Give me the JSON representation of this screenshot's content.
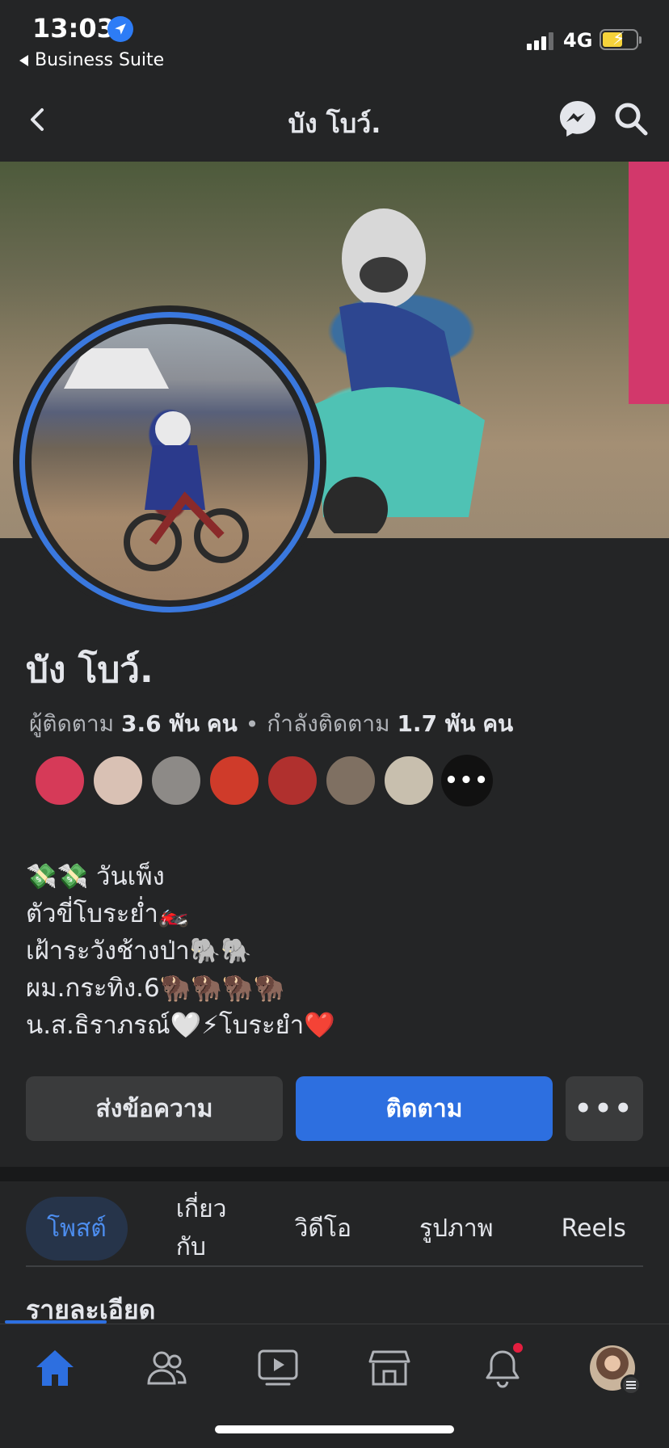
{
  "status_bar": {
    "time": "13:03",
    "back_app": "Business Suite",
    "network": "4G"
  },
  "header": {
    "title": "บัง โบว์."
  },
  "profile": {
    "name": "บัง โบว์.",
    "followers_label": "ผู้ติดตาม",
    "followers_count": "3.6 พัน",
    "followers_unit": "คน",
    "separator": "•",
    "following_label": "กำลังติดตาม",
    "following_count": "1.7 พัน",
    "following_unit": "คน",
    "more_friends": "•••"
  },
  "friends": [
    {
      "color": "#d63a58"
    },
    {
      "color": "#d9c1b4"
    },
    {
      "color": "#8d8a87"
    },
    {
      "color": "#cf3b2a"
    },
    {
      "color": "#b0302e"
    },
    {
      "color": "#7f7062"
    },
    {
      "color": "#c8bfae"
    }
  ],
  "bio": [
    "💸💸 วันเพ็ง",
    "ตัวขี่โบระย่ำ🏍️",
    "เฝ้าระวังช้างป่า🐘🐘",
    "ผม.กระทิง.6🦬🦬🦬🦬",
    "น.ส.ธิราภรณ์🤍⚡โบระยำ❤️"
  ],
  "actions": {
    "message": "ส่งข้อความ",
    "follow": "ติดตาม",
    "more": "•••"
  },
  "tabs": [
    {
      "label": "โพสต์",
      "active": true
    },
    {
      "label": "เกี่ยวกับ",
      "active": false
    },
    {
      "label": "วิดีโอ",
      "active": false
    },
    {
      "label": "รูปภาพ",
      "active": false
    },
    {
      "label": "Reels",
      "active": false
    }
  ],
  "section": {
    "title": "รายละเอียด"
  },
  "colors": {
    "background": "#242526",
    "accent": "#2d6fe0",
    "notification": "#e41e3f"
  },
  "bottom_nav": [
    "home-icon",
    "friends-icon",
    "watch-icon",
    "marketplace-icon",
    "notifications-icon",
    "profile-menu"
  ]
}
